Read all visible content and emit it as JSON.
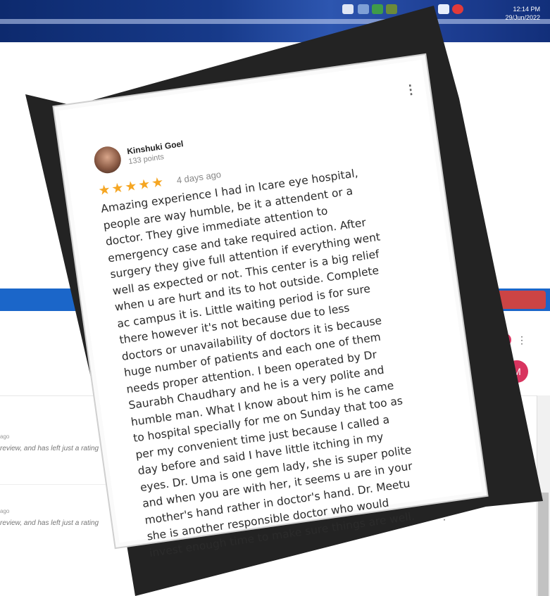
{
  "taskbar": {
    "time": "12:14 PM",
    "date": "29/Jun/2022"
  },
  "browser": {
    "profile_initial": "M",
    "apps_icon": "apps-grid-icon"
  },
  "background_reviews": [
    {
      "meta": "review, and has left just a rating",
      "ago": "ago"
    },
    {
      "meta": "review, and has left just a rating",
      "ago": "ago"
    }
  ],
  "review": {
    "author": "Kinshuki Goel",
    "points": "133 points",
    "rating": 5,
    "stars": "★★★★★",
    "date": "4 days ago",
    "text": "Amazing experience I had in Icare eye hospital,\npeople are way humble, be it a attendent or a\ndoctor. They give immediate attention to\nemergency case and take required action. After\nsurgery they give full attention if everything went\nwell as expected or not. This center is a big relief\nwhen u are hurt and its to hot outside. Complete\nac campus it is. Little waiting period is for sure\nthere however it's not because due to less\ndoctors or unavailability of doctors it is because\nhuge number of patients and each one of them\nneeds proper attention. I been operated by Dr\nSaurabh Chaudhary and he is a very polite and\nhumble man. What I know about him is he came\nto hospital specially for me on Sunday that too as\nper my convenient time just because I called a\nday before and said I have little itching in my\neyes. Dr. Uma is one gem lady, she is super polite\nand when you are with her, it seems u are in your\nmother's hand rather in doctor's hand. Dr. Meetu\nshe is another responsible doctor who would\ninvest enough time to make sure things are well."
  },
  "colors": {
    "star": "#f5a623",
    "taskbar": "#173a8a",
    "browser_title": "#1b66c9",
    "profile": "#d8345f"
  }
}
